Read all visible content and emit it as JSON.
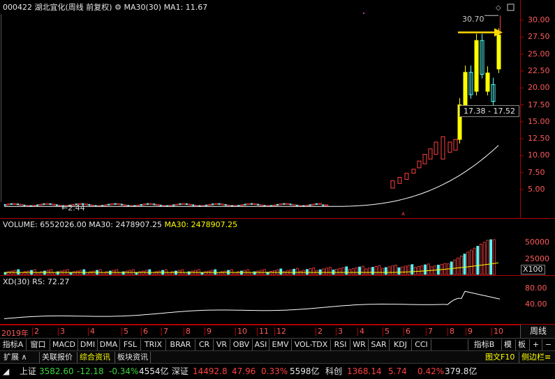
{
  "main_header": {
    "code": "000422",
    "name": "湖北宜化(周线 前复权)",
    "ma30_label": "MA30(30)",
    "ma1_label": "MA1: 11.67"
  },
  "price_axis": [
    "30.00",
    "27.50",
    "25.00",
    "22.50",
    "20.00",
    "17.50",
    "15.00",
    "12.50",
    "10.00",
    "7.50",
    "5.00"
  ],
  "price_annotations": {
    "high": "30.70",
    "low_marker": "2.44",
    "range_box": "17.38 - 17.52"
  },
  "volume_header": {
    "label": "VOLUME: 6552026.00",
    "ma30": "MA30: 2478907.25",
    "ma30_b": "MA30: 2478907.25"
  },
  "volume_axis": [
    "50000",
    "25000"
  ],
  "volume_unit": "X100",
  "xd_header": {
    "label": "XD(30)",
    "rs": "RS: 72.27"
  },
  "xd_axis": [
    "80.00",
    "40.00"
  ],
  "date_axis": {
    "year": "2019年",
    "months": [
      "2",
      "3",
      "4",
      "5",
      "6",
      "7",
      "8",
      "9",
      "10",
      "11",
      "12",
      "2",
      "3",
      "4",
      "5",
      "6",
      "7",
      "8",
      "9",
      "10"
    ],
    "period": "周线"
  },
  "indicator_tabs": [
    "指标A",
    "窗口",
    "MACD",
    "DMI",
    "DMA",
    "FSL",
    "TRIX",
    "BRAR",
    "CR",
    "VR",
    "OBV",
    "ASI",
    "EMV",
    "VOL-TDX",
    "RSI",
    "WR",
    "SAR",
    "KDJ",
    "CCI"
  ],
  "indicator_right": [
    "指标B",
    "模",
    "板",
    "+",
    "−"
  ],
  "bottom_tabs": {
    "expand": "扩展",
    "items": [
      "关联报价",
      "综合资讯",
      "板块资讯"
    ],
    "right": [
      "图文F10",
      "侧边栏"
    ]
  },
  "status": {
    "sh_name": "上证",
    "sh_price": "3582.60",
    "sh_change": "-12.18",
    "sh_pct": "-0.34%",
    "sh_amount": "4554亿",
    "sz_name": "深证",
    "sz_price": "14492.8",
    "sz_change": "47.96",
    "sz_pct": "0.33%",
    "sz_amount": "5598亿",
    "kc_name": "科创",
    "kc_price": "1368.14",
    "kc_change": "5.74",
    "kc_pct": "0.42%",
    "kc_amount": "379.8亿"
  },
  "colors": {
    "up": "#ff4040",
    "down": "#54ffff",
    "rise_candle": "#ffff00",
    "axis": "#b00000",
    "ma": "#ffffff"
  },
  "chart_data": {
    "type": "candlestick",
    "title": "000422 湖北宜化(周线 前复权)",
    "period": "weekly",
    "x_range_labels": [
      "2019年",
      "10"
    ],
    "ylim": [
      2.0,
      31.5
    ],
    "notable_high": 30.7,
    "notable_low": 2.44,
    "late_candles": [
      {
        "o": 10.8,
        "c": 12.4
      },
      {
        "o": 12.4,
        "c": 17.5
      },
      {
        "o": 17.5,
        "c": 22.3
      },
      {
        "o": 22.3,
        "c": 19.0
      },
      {
        "o": 19.5,
        "c": 27.0
      },
      {
        "o": 27.0,
        "c": 22.0
      },
      {
        "o": 19.5,
        "c": 22.2
      },
      {
        "o": 20.5,
        "c": 18.0
      },
      {
        "o": 22.8,
        "c": 27.8
      }
    ],
    "ma30_last": 11.67,
    "volume_ma30": 2478907.25,
    "rs_last": 72.27
  }
}
